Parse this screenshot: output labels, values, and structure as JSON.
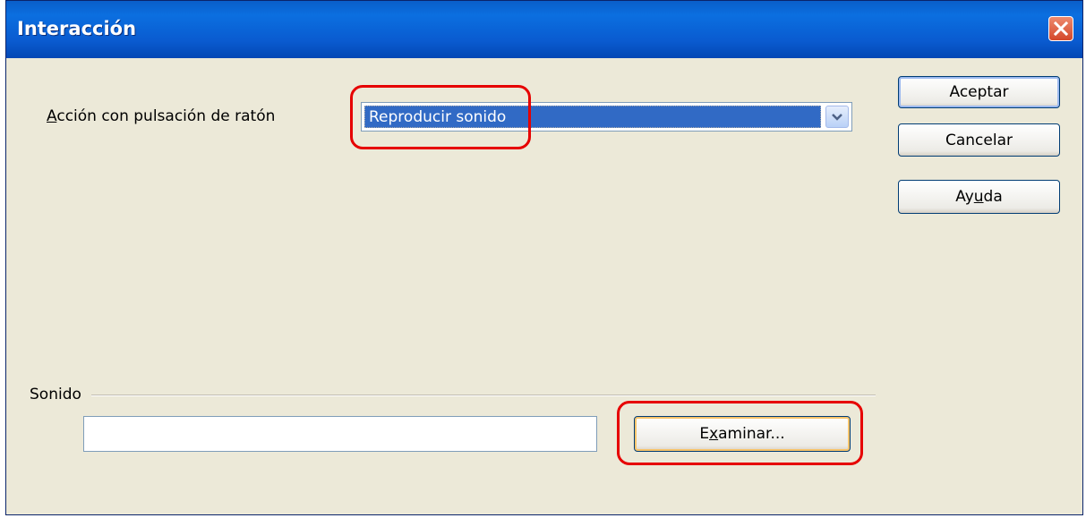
{
  "window": {
    "title": "Interacción",
    "close_icon": "close-icon"
  },
  "action": {
    "label": "Acción con pulsación de ratón",
    "selected": "Reproducir sonido"
  },
  "buttons": {
    "ok": "Aceptar",
    "cancel": "Cancelar",
    "help": "Ayuda"
  },
  "sound": {
    "label": "Sonido",
    "path_value": "",
    "browse": "Examinar..."
  },
  "colors": {
    "title_bar": "#0a5ec9",
    "dialog_bg": "#ece9d8",
    "selection": "#316ac5",
    "highlight": "#e60000"
  }
}
